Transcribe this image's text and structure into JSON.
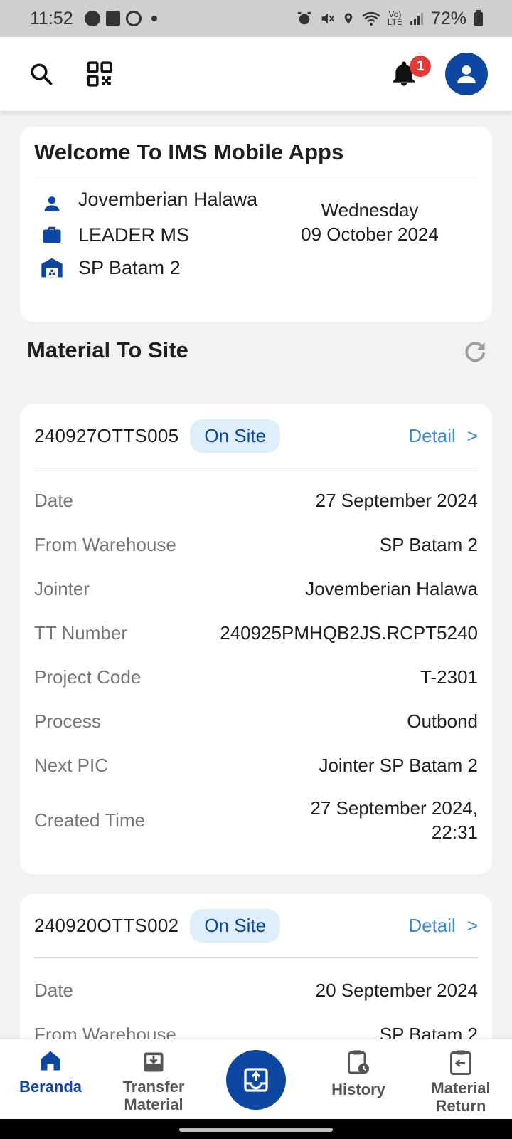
{
  "status_bar": {
    "time": "11:52",
    "battery": "72%"
  },
  "app_bar": {
    "notification_count": "1"
  },
  "welcome": {
    "title": "Welcome To IMS Mobile Apps",
    "user_name": "Jovemberian Halawa",
    "role": "LEADER MS",
    "location": "SP Batam 2",
    "day": "Wednesday",
    "date": "09 October 2024"
  },
  "section": {
    "title": "Material To Site"
  },
  "cards": [
    {
      "id": "240927OTTS005",
      "status": "On Site",
      "detail_label": "Detail",
      "detail_arrow": ">",
      "rows": [
        {
          "label": "Date",
          "value": "27 September 2024"
        },
        {
          "label": "From Warehouse",
          "value": "SP Batam 2"
        },
        {
          "label": "Jointer",
          "value": "Jovemberian Halawa"
        },
        {
          "label": "TT Number",
          "value": "240925PMHQB2JS.RCPT5240"
        },
        {
          "label": "Project Code",
          "value": "T-2301"
        },
        {
          "label": "Process",
          "value": "Outbond"
        },
        {
          "label": "Next PIC",
          "value": "Jointer SP Batam 2"
        }
      ],
      "created_label": "Created Time",
      "created_line1": "27 September 2024,",
      "created_line2": "22:31"
    },
    {
      "id": "240920OTTS002",
      "status": "On Site",
      "detail_label": "Detail",
      "detail_arrow": ">",
      "rows": [
        {
          "label": "Date",
          "value": "20 September 2024"
        },
        {
          "label": "From Warehouse",
          "value": "SP Batam 2"
        }
      ]
    }
  ],
  "bottom_nav": {
    "beranda": "Beranda",
    "transfer_1": "Transfer",
    "transfer_2": "Material",
    "history": "History",
    "return_1": "Material",
    "return_2": "Return"
  },
  "colors": {
    "primary": "#0d47a1",
    "link": "#3d8ad6",
    "pill_bg": "#deeefa",
    "badge": "#e53935"
  }
}
